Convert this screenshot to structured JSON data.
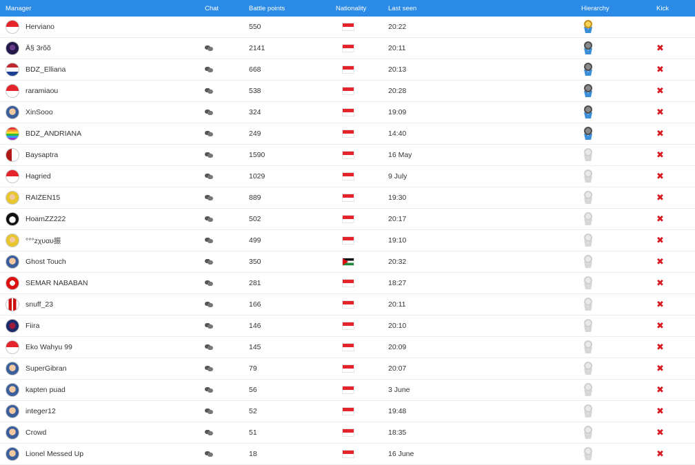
{
  "header": {
    "manager": "Manager",
    "chat": "Chat",
    "points": "Battle points",
    "nationality": "Nationality",
    "last_seen": "Last seen",
    "hierarchy": "Hierarchy",
    "kick": "Kick"
  },
  "icons": {
    "chat": "chat-bubbles-icon",
    "kick": "✖",
    "medal_gold": "gold-medal-icon",
    "medal_silver": "silver-medal-icon",
    "medal_grey": "grey-medal-icon"
  },
  "colors": {
    "header_bg": "#2b8ae6",
    "kick": "#d9181f"
  },
  "rows": [
    {
      "name": "Herviano",
      "points": "550",
      "seen": "20:22",
      "flag": "id",
      "avatar": "av-flag",
      "medal": "gold",
      "chat": false,
      "kick": false
    },
    {
      "name": "Ä§ 3rõõ",
      "points": "2141",
      "seen": "20:11",
      "flag": "id",
      "avatar": "av-dark",
      "medal": "silver",
      "chat": true,
      "kick": true
    },
    {
      "name": "BDZ_Elliana",
      "points": "668",
      "seen": "20:13",
      "flag": "id",
      "avatar": "av-nl",
      "medal": "silver",
      "chat": true,
      "kick": true
    },
    {
      "name": "raramiaou",
      "points": "538",
      "seen": "20:28",
      "flag": "id",
      "avatar": "av-flag",
      "medal": "silver",
      "chat": true,
      "kick": true
    },
    {
      "name": "XinSooo",
      "points": "324",
      "seen": "19:09",
      "flag": "id",
      "avatar": "av-face",
      "medal": "silver",
      "chat": true,
      "kick": true
    },
    {
      "name": "BDZ_ANDRIANA",
      "points": "249",
      "seen": "14:40",
      "flag": "id",
      "avatar": "av-rainbow",
      "medal": "silver",
      "chat": true,
      "kick": true
    },
    {
      "name": "Baysaptra",
      "points": "1590",
      "seen": "16 May",
      "flag": "id",
      "avatar": "av-redwhite",
      "medal": "grey",
      "chat": true,
      "kick": true
    },
    {
      "name": "Hagried",
      "points": "1029",
      "seen": "9 July",
      "flag": "id",
      "avatar": "av-flag",
      "medal": "grey",
      "chat": true,
      "kick": true
    },
    {
      "name": "RAIZEN15",
      "points": "889",
      "seen": "19:30",
      "flag": "id",
      "avatar": "av-yellow",
      "medal": "grey",
      "chat": true,
      "kick": true
    },
    {
      "name": "HoamZZ222",
      "points": "502",
      "seen": "20:17",
      "flag": "id",
      "avatar": "av-black",
      "medal": "grey",
      "chat": true,
      "kick": true
    },
    {
      "name": "°°°zχυαυ振",
      "points": "499",
      "seen": "19:10",
      "flag": "id",
      "avatar": "av-yellow",
      "medal": "grey",
      "chat": true,
      "kick": true
    },
    {
      "name": "Ghost Touch",
      "points": "350",
      "seen": "20:32",
      "flag": "ps",
      "avatar": "av-face",
      "medal": "grey",
      "chat": true,
      "kick": true
    },
    {
      "name": "SEMAR NABABAN",
      "points": "281",
      "seen": "18:27",
      "flag": "id",
      "avatar": "av-ball",
      "medal": "grey",
      "chat": true,
      "kick": true
    },
    {
      "name": "snuff_23",
      "points": "166",
      "seen": "20:11",
      "flag": "id",
      "avatar": "av-jersey",
      "medal": "grey",
      "chat": true,
      "kick": true
    },
    {
      "name": "Fiira",
      "points": "146",
      "seen": "20:10",
      "flag": "id",
      "avatar": "av-navy",
      "medal": "grey",
      "chat": true,
      "kick": true
    },
    {
      "name": "Eko Wahyu 99",
      "points": "145",
      "seen": "20:09",
      "flag": "id",
      "avatar": "av-flag",
      "medal": "grey",
      "chat": true,
      "kick": true
    },
    {
      "name": "SuperGibran",
      "points": "79",
      "seen": "20:07",
      "flag": "id",
      "avatar": "av-face",
      "medal": "grey",
      "chat": true,
      "kick": true
    },
    {
      "name": "kapten puad",
      "points": "56",
      "seen": "3 June",
      "flag": "id",
      "avatar": "av-face",
      "medal": "grey",
      "chat": true,
      "kick": true
    },
    {
      "name": "integer12",
      "points": "52",
      "seen": "19:48",
      "flag": "id",
      "avatar": "av-face",
      "medal": "grey",
      "chat": true,
      "kick": true
    },
    {
      "name": "Crowd",
      "points": "51",
      "seen": "18:35",
      "flag": "id",
      "avatar": "av-face",
      "medal": "grey",
      "chat": true,
      "kick": true
    },
    {
      "name": "Lionel Messed Up",
      "points": "18",
      "seen": "16 June",
      "flag": "id",
      "avatar": "av-face",
      "medal": "grey",
      "chat": true,
      "kick": true
    }
  ]
}
